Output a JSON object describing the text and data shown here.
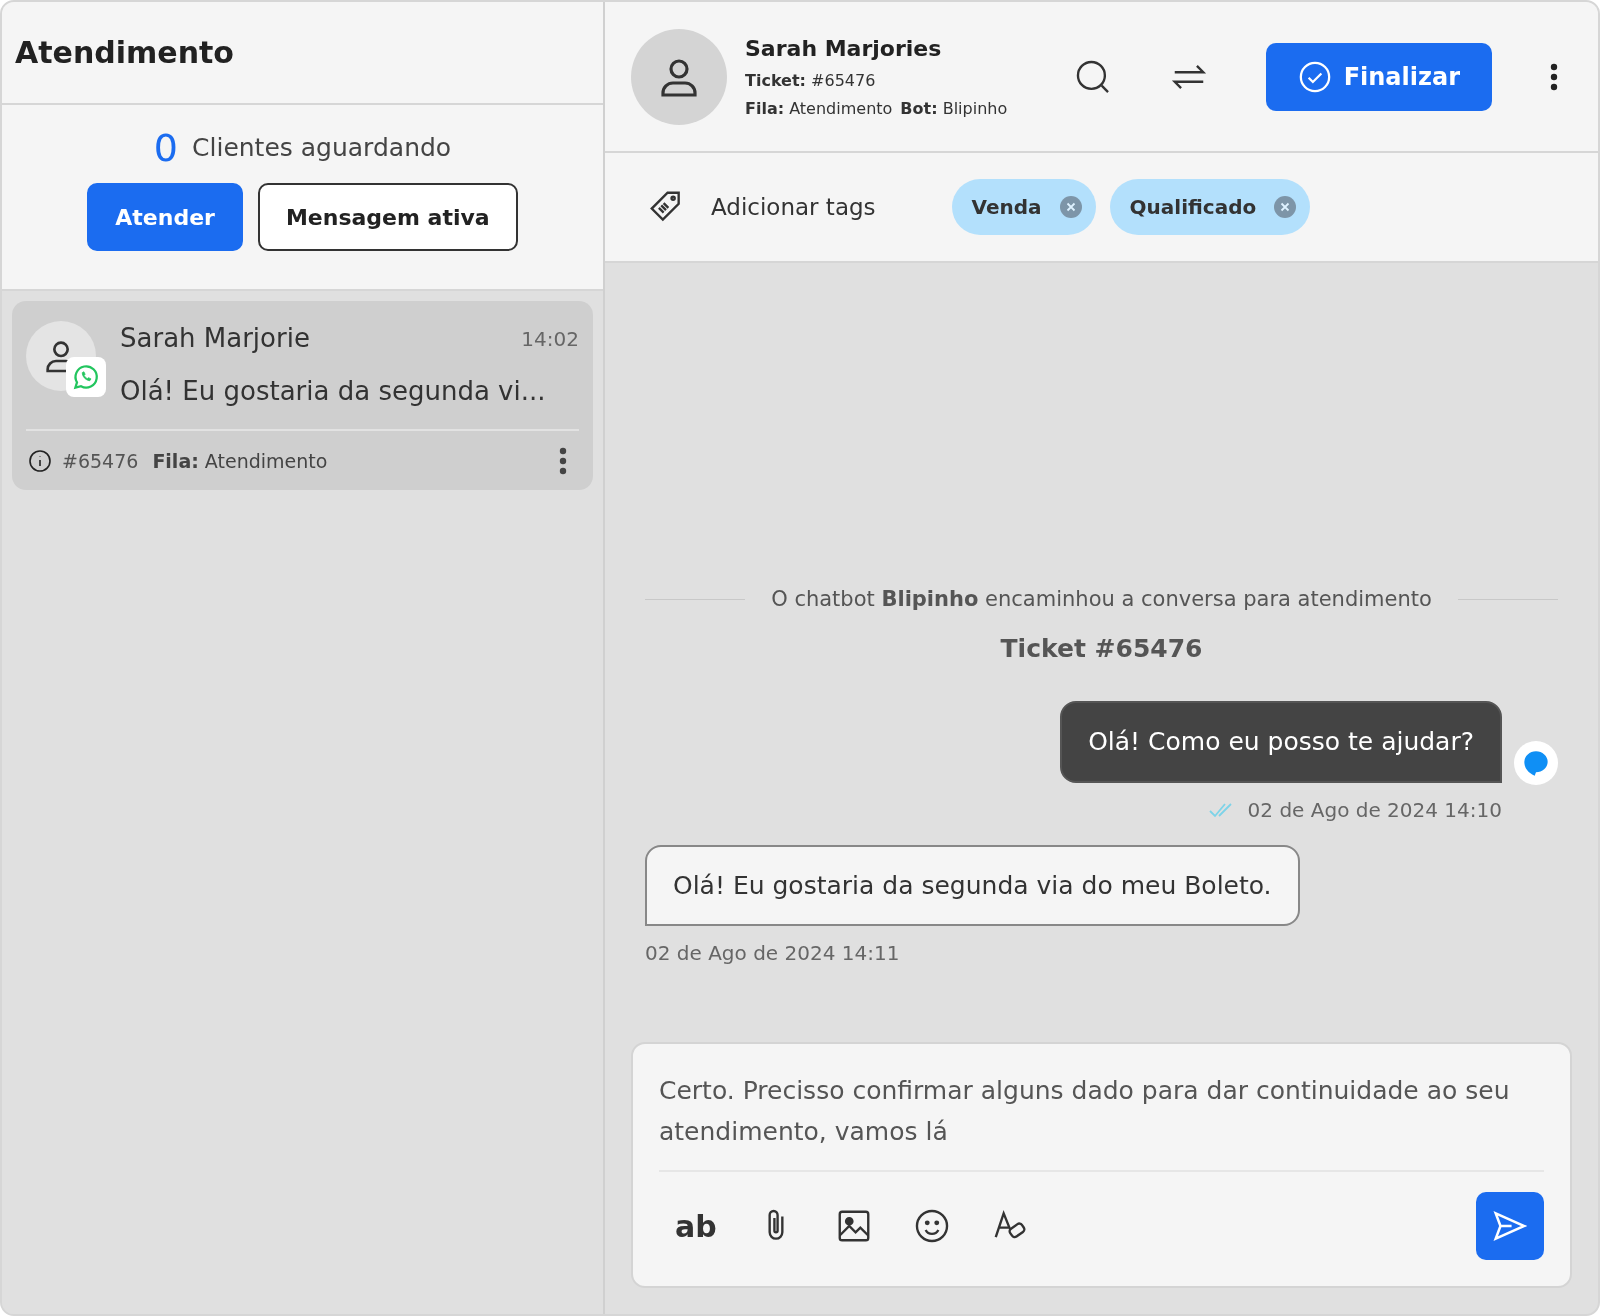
{
  "sidebar": {
    "title": "Atendimento",
    "waiting_count": "0",
    "waiting_label": "Clientes aguardando",
    "buttons": [
      {
        "label": "Atender",
        "kind": "primary"
      },
      {
        "label": "Mensagem ativa",
        "kind": "outline"
      }
    ],
    "conversations": [
      {
        "name": "Sarah Marjorie",
        "time": "14:02",
        "preview": "Olá! Eu gostaria da segunda vi...",
        "ticket": "#65476",
        "queue": "**Fila:** Atendimento",
        "selected": true
      }
    ]
  },
  "chat_header": {
    "name": "Sarah Marjories",
    "ticket": "**Ticket:** #65476",
    "queue": "**Fila:** Atendimento",
    "bot": "**Bot:** Blipinho",
    "finish_button": "Finalizar"
  },
  "tags_bar": {
    "add_label": "Adicionar tags",
    "tags": [
      "Venda",
      "Qualificado"
    ]
  },
  "messages": [
    {
      "kind": "system",
      "text": "O chatbot **Blipinho** encaminhou a conversa para atendimento",
      "title": "Ticket #65476"
    },
    {
      "kind": "outgoing",
      "text": "Olá! Como eu posso te ajudar?",
      "time": "02 de Ago de 2024 14:10",
      "read": true
    },
    {
      "kind": "incoming",
      "text": "Olá! Eu gostaria da segunda via do meu Boleto.",
      "time": "02 de Ago de 2024 14:11"
    }
  ],
  "composer": {
    "value": "Certo. Precisso confirmar alguns dado para dar continuidade ao seu atendimento, vamos lá",
    "format_label": "ab"
  }
}
